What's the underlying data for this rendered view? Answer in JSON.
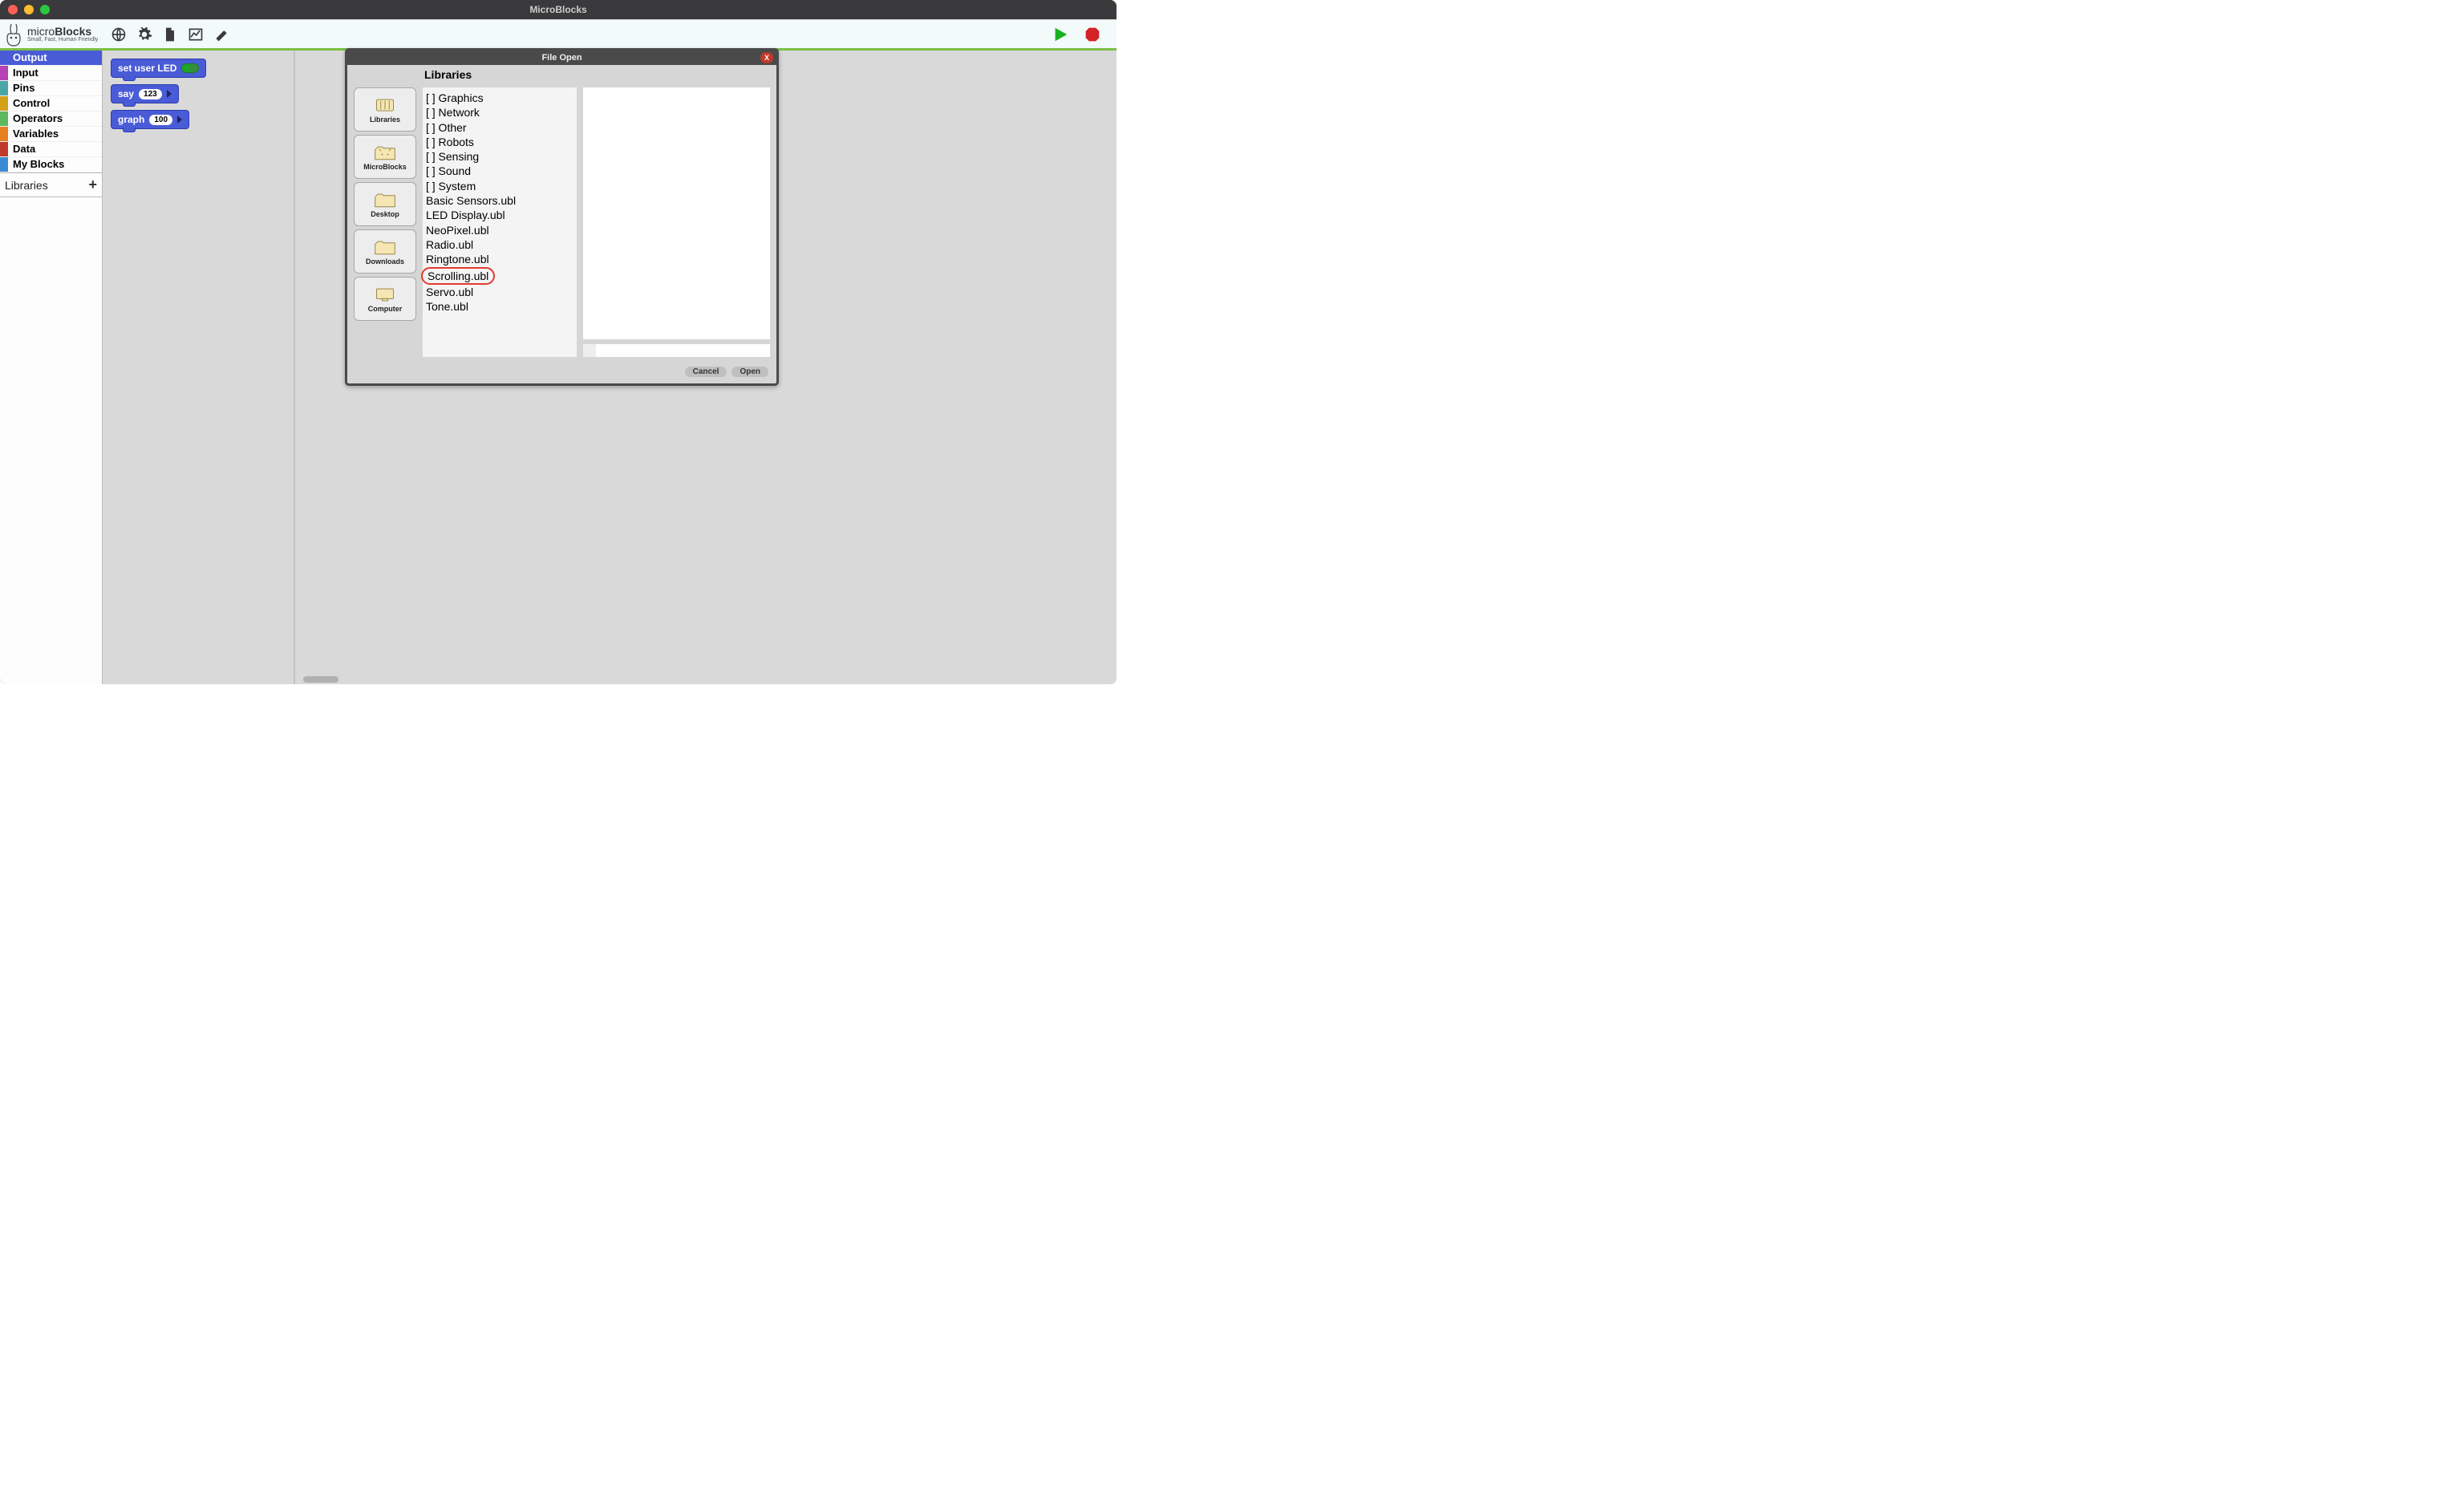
{
  "window": {
    "title": "MicroBlocks"
  },
  "logo": {
    "name": "microBlocks",
    "tagline": "Small, Fast, Human Friendly"
  },
  "categories": [
    {
      "label": "Output",
      "color": "#4a5bd7",
      "selected": true
    },
    {
      "label": "Input",
      "color": "#b541b5",
      "selected": false
    },
    {
      "label": "Pins",
      "color": "#4aa6a6",
      "selected": false
    },
    {
      "label": "Control",
      "color": "#d4a017",
      "selected": false
    },
    {
      "label": "Operators",
      "color": "#5cb85c",
      "selected": false
    },
    {
      "label": "Variables",
      "color": "#e67e22",
      "selected": false
    },
    {
      "label": "Data",
      "color": "#c0392b",
      "selected": false
    },
    {
      "label": "My Blocks",
      "color": "#3b8bd4",
      "selected": false
    }
  ],
  "sidebar": {
    "libraries_label": "Libraries",
    "add_symbol": "+"
  },
  "blocks": {
    "set_user_led": "set user LED",
    "say": "say",
    "say_value": "123",
    "graph": "graph",
    "graph_value": "100"
  },
  "dialog": {
    "title": "File Open",
    "close": "X",
    "header": "Libraries",
    "folders": [
      {
        "label": "Libraries",
        "icon": "library"
      },
      {
        "label": "MicroBlocks",
        "icon": "cat"
      },
      {
        "label": "Desktop",
        "icon": "folder"
      },
      {
        "label": "Downloads",
        "icon": "folder"
      },
      {
        "label": "Computer",
        "icon": "computer"
      }
    ],
    "files": [
      "[ ] Graphics",
      "[ ] Network",
      "[ ] Other",
      "[ ] Robots",
      "[ ] Sensing",
      "[ ] Sound",
      "[ ] System",
      "Basic Sensors.ubl",
      "LED Display.ubl",
      "NeoPixel.ubl",
      "Radio.ubl",
      "Ringtone.ubl",
      "Scrolling.ubl",
      "Servo.ubl",
      "Tone.ubl"
    ],
    "highlighted_index": 12,
    "cancel": "Cancel",
    "open": "Open"
  }
}
